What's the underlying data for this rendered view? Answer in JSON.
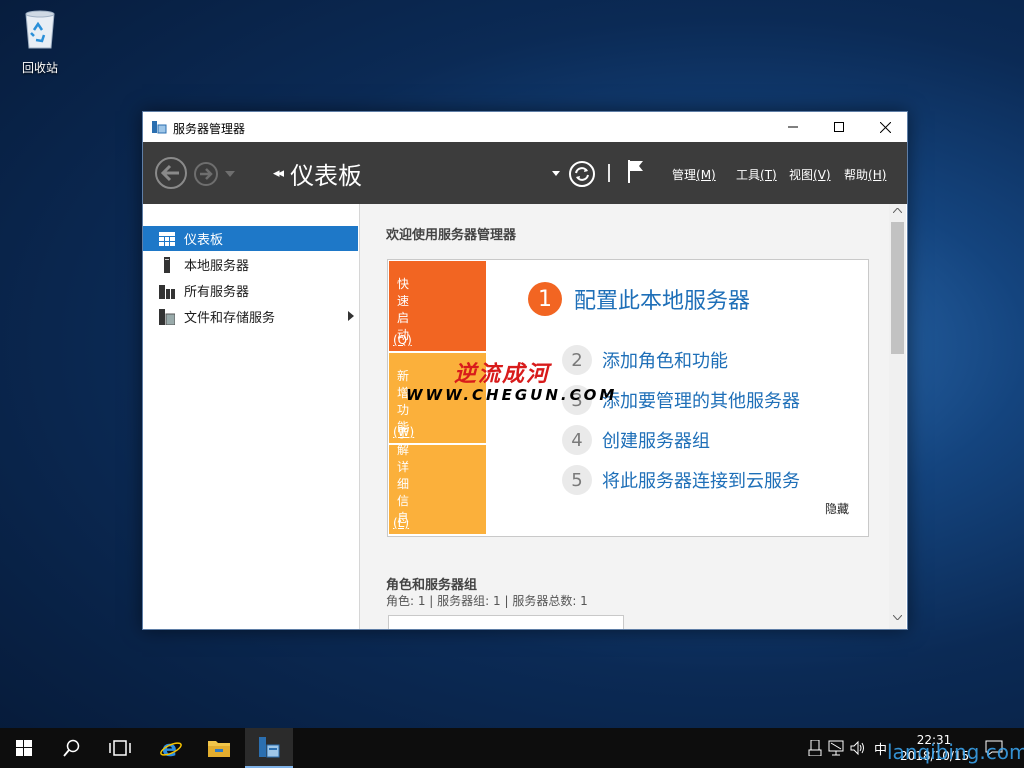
{
  "desktop": {
    "recycle_bin_label": "回收站"
  },
  "window": {
    "title": "服务器管理器",
    "breadcrumb": "仪表板",
    "menus": [
      {
        "label": "管理",
        "key": "(M)"
      },
      {
        "label": "工具",
        "key": "(T)"
      },
      {
        "label": "视图",
        "key": "(V)"
      },
      {
        "label": "帮助",
        "key": "(H)"
      }
    ]
  },
  "sidebar": {
    "items": [
      {
        "label": "仪表板",
        "icon": "dashboard-icon",
        "active": true
      },
      {
        "label": "本地服务器",
        "icon": "server-icon"
      },
      {
        "label": "所有服务器",
        "icon": "servers-icon"
      },
      {
        "label": "文件和存储服务",
        "icon": "storage-icon",
        "has_submenu": true
      }
    ]
  },
  "content": {
    "welcome": "欢迎使用服务器管理器",
    "tiles": [
      {
        "label": "快速启动",
        "key": "(Q)",
        "color": "#f26522"
      },
      {
        "label": "新增功能",
        "key": "(W)",
        "color": "#fbb03b"
      },
      {
        "label": "了解详细信息",
        "key": "(L)",
        "color": "#fbb03b"
      }
    ],
    "steps": [
      {
        "num": "1",
        "label": "配置此本地服务器"
      },
      {
        "num": "2",
        "label": "添加角色和功能"
      },
      {
        "num": "3",
        "label": "添加要管理的其他服务器"
      },
      {
        "num": "4",
        "label": "创建服务器组"
      },
      {
        "num": "5",
        "label": "将此服务器连接到云服务"
      }
    ],
    "hide": "隐藏",
    "watermark_cn": "逆流成河",
    "watermark_url": "WWW.CHEGUN.COM",
    "roles_title": "角色和服务器组",
    "roles_stats": "角色: 1 | 服务器组: 1 | 服务器总数: 1"
  },
  "taskbar": {
    "ime": "中",
    "time": "22:31",
    "date": "2018/10/15"
  },
  "site_watermark": "lanqibing.com",
  "colors": {
    "accent": "#1e78c8",
    "tile_orange": "#f26522",
    "tile_yellow": "#fbb03b",
    "link": "#1e6fb8"
  }
}
